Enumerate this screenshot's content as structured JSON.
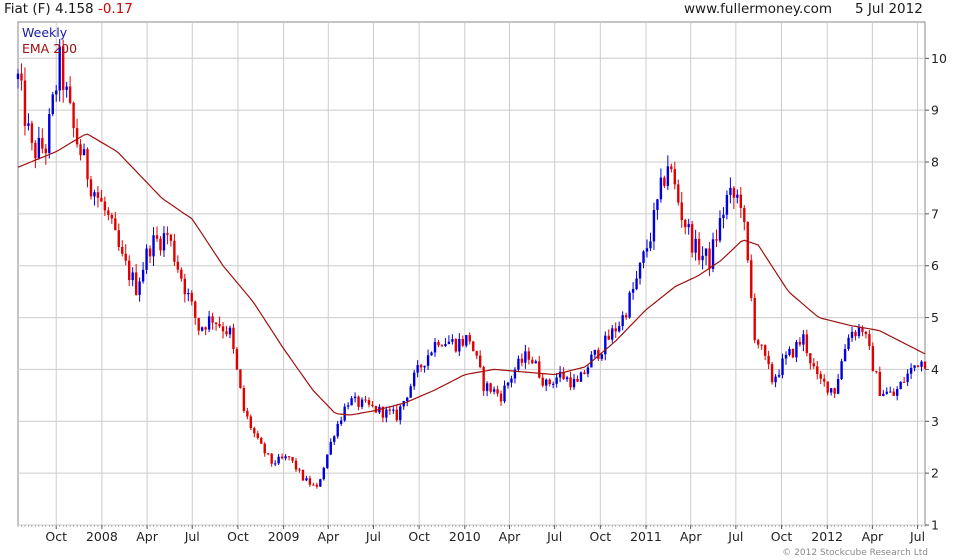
{
  "header": {
    "title": "Fiat (F)",
    "price": "4.158",
    "change": "-0.17",
    "source": "www.fullermoney.com",
    "date": "5 Jul 2012"
  },
  "legend": {
    "period": "Weekly",
    "ema": "EMA 200"
  },
  "copyright": "© 2012 Stockcube Research Ltd",
  "colors": {
    "up": "#0000dd",
    "down": "#e00000",
    "ema": "#a01010",
    "grid": "#cccccc",
    "change": "#d00000",
    "period": "#1a1aa0"
  },
  "chart_data": {
    "type": "line",
    "title": "Fiat (F)",
    "xlabel": "",
    "ylabel": "",
    "ylim": [
      1,
      10.7
    ],
    "yticks": [
      1,
      2,
      3,
      4,
      5,
      6,
      7,
      8,
      9,
      10
    ],
    "xticks": [
      {
        "label": "Oct",
        "date": "2007-10-01"
      },
      {
        "label": "2008",
        "date": "2008-01-01"
      },
      {
        "label": "Apr",
        "date": "2008-04-01"
      },
      {
        "label": "Jul",
        "date": "2008-07-01"
      },
      {
        "label": "Oct",
        "date": "2008-10-01"
      },
      {
        "label": "2009",
        "date": "2009-01-01"
      },
      {
        "label": "Apr",
        "date": "2009-04-01"
      },
      {
        "label": "Jul",
        "date": "2009-07-01"
      },
      {
        "label": "Oct",
        "date": "2009-10-01"
      },
      {
        "label": "2010",
        "date": "2010-01-01"
      },
      {
        "label": "Apr",
        "date": "2010-04-01"
      },
      {
        "label": "Jul",
        "date": "2010-07-01"
      },
      {
        "label": "Oct",
        "date": "2010-10-01"
      },
      {
        "label": "2011",
        "date": "2011-01-01"
      },
      {
        "label": "Apr",
        "date": "2011-04-01"
      },
      {
        "label": "Jul",
        "date": "2011-07-01"
      },
      {
        "label": "Oct",
        "date": "2011-10-01"
      },
      {
        "label": "2012",
        "date": "2012-01-01"
      },
      {
        "label": "Apr",
        "date": "2012-04-01"
      },
      {
        "label": "Jul",
        "date": "2012-07-01"
      }
    ],
    "x_range": [
      "2007-07-16",
      "2012-07-16"
    ],
    "grid": true,
    "y_axis_side": "right",
    "legend_position": "top-left",
    "series": [
      {
        "name": "Weekly",
        "style": "candlestick",
        "x": [
          "2007-07-16",
          "2007-08-13",
          "2007-09-10",
          "2007-10-08",
          "2007-11-05",
          "2007-12-10",
          "2008-01-14",
          "2008-02-11",
          "2008-03-10",
          "2008-04-07",
          "2008-05-12",
          "2008-06-09",
          "2008-07-14",
          "2008-08-11",
          "2008-09-15",
          "2008-10-13",
          "2008-11-10",
          "2008-12-08",
          "2009-01-12",
          "2009-02-09",
          "2009-03-09",
          "2009-04-13",
          "2009-05-11",
          "2009-06-15",
          "2009-07-13",
          "2009-08-17",
          "2009-09-14",
          "2009-10-12",
          "2009-11-09",
          "2009-12-14",
          "2010-01-11",
          "2010-02-08",
          "2010-03-15",
          "2010-04-12",
          "2010-05-10",
          "2010-06-14",
          "2010-07-12",
          "2010-08-16",
          "2010-09-13",
          "2010-10-11",
          "2010-11-15",
          "2010-12-13",
          "2011-01-10",
          "2011-02-14",
          "2011-03-14",
          "2011-04-11",
          "2011-05-09",
          "2011-06-13",
          "2011-07-11",
          "2011-08-08",
          "2011-09-12",
          "2011-10-10",
          "2011-11-14",
          "2011-12-12",
          "2012-01-16",
          "2012-02-13",
          "2012-03-12",
          "2012-04-16",
          "2012-05-14",
          "2012-06-11",
          "2012-07-02"
        ],
        "close": [
          9.6,
          8.2,
          8.3,
          9.9,
          8.6,
          7.6,
          6.9,
          6.1,
          5.6,
          6.4,
          6.6,
          5.8,
          4.8,
          5.0,
          4.7,
          3.2,
          2.6,
          2.2,
          2.3,
          1.9,
          1.7,
          2.8,
          3.4,
          3.3,
          3.2,
          3.1,
          3.7,
          4.2,
          4.6,
          4.5,
          4.6,
          3.7,
          3.5,
          4.0,
          4.3,
          3.7,
          3.9,
          3.7,
          4.2,
          4.5,
          5.0,
          5.7,
          6.6,
          8.0,
          7.0,
          6.3,
          6.1,
          7.3,
          7.3,
          4.7,
          3.8,
          4.2,
          4.6,
          3.8,
          3.6,
          4.7,
          4.8,
          3.6,
          3.5,
          3.9,
          4.16
        ]
      },
      {
        "name": "EMA 200",
        "style": "line",
        "x": [
          "2007-07-16",
          "2007-10-01",
          "2007-12-01",
          "2008-02-01",
          "2008-05-01",
          "2008-07-01",
          "2008-09-01",
          "2008-11-01",
          "2009-01-01",
          "2009-03-01",
          "2009-04-15",
          "2009-05-15",
          "2009-07-01",
          "2009-09-01",
          "2009-11-01",
          "2010-01-01",
          "2010-03-01",
          "2010-05-01",
          "2010-07-01",
          "2010-09-01",
          "2010-11-01",
          "2011-01-01",
          "2011-03-01",
          "2011-04-15",
          "2011-06-01",
          "2011-07-15",
          "2011-08-15",
          "2011-10-15",
          "2011-12-15",
          "2012-02-15",
          "2012-04-15",
          "2012-07-16"
        ],
        "values": [
          7.9,
          8.2,
          8.55,
          8.2,
          7.3,
          6.9,
          6.0,
          5.3,
          4.4,
          3.6,
          3.15,
          3.12,
          3.2,
          3.35,
          3.6,
          3.9,
          4.0,
          3.95,
          3.9,
          4.05,
          4.55,
          5.15,
          5.6,
          5.8,
          6.1,
          6.5,
          6.4,
          5.5,
          5.0,
          4.85,
          4.75,
          4.3
        ]
      }
    ]
  }
}
